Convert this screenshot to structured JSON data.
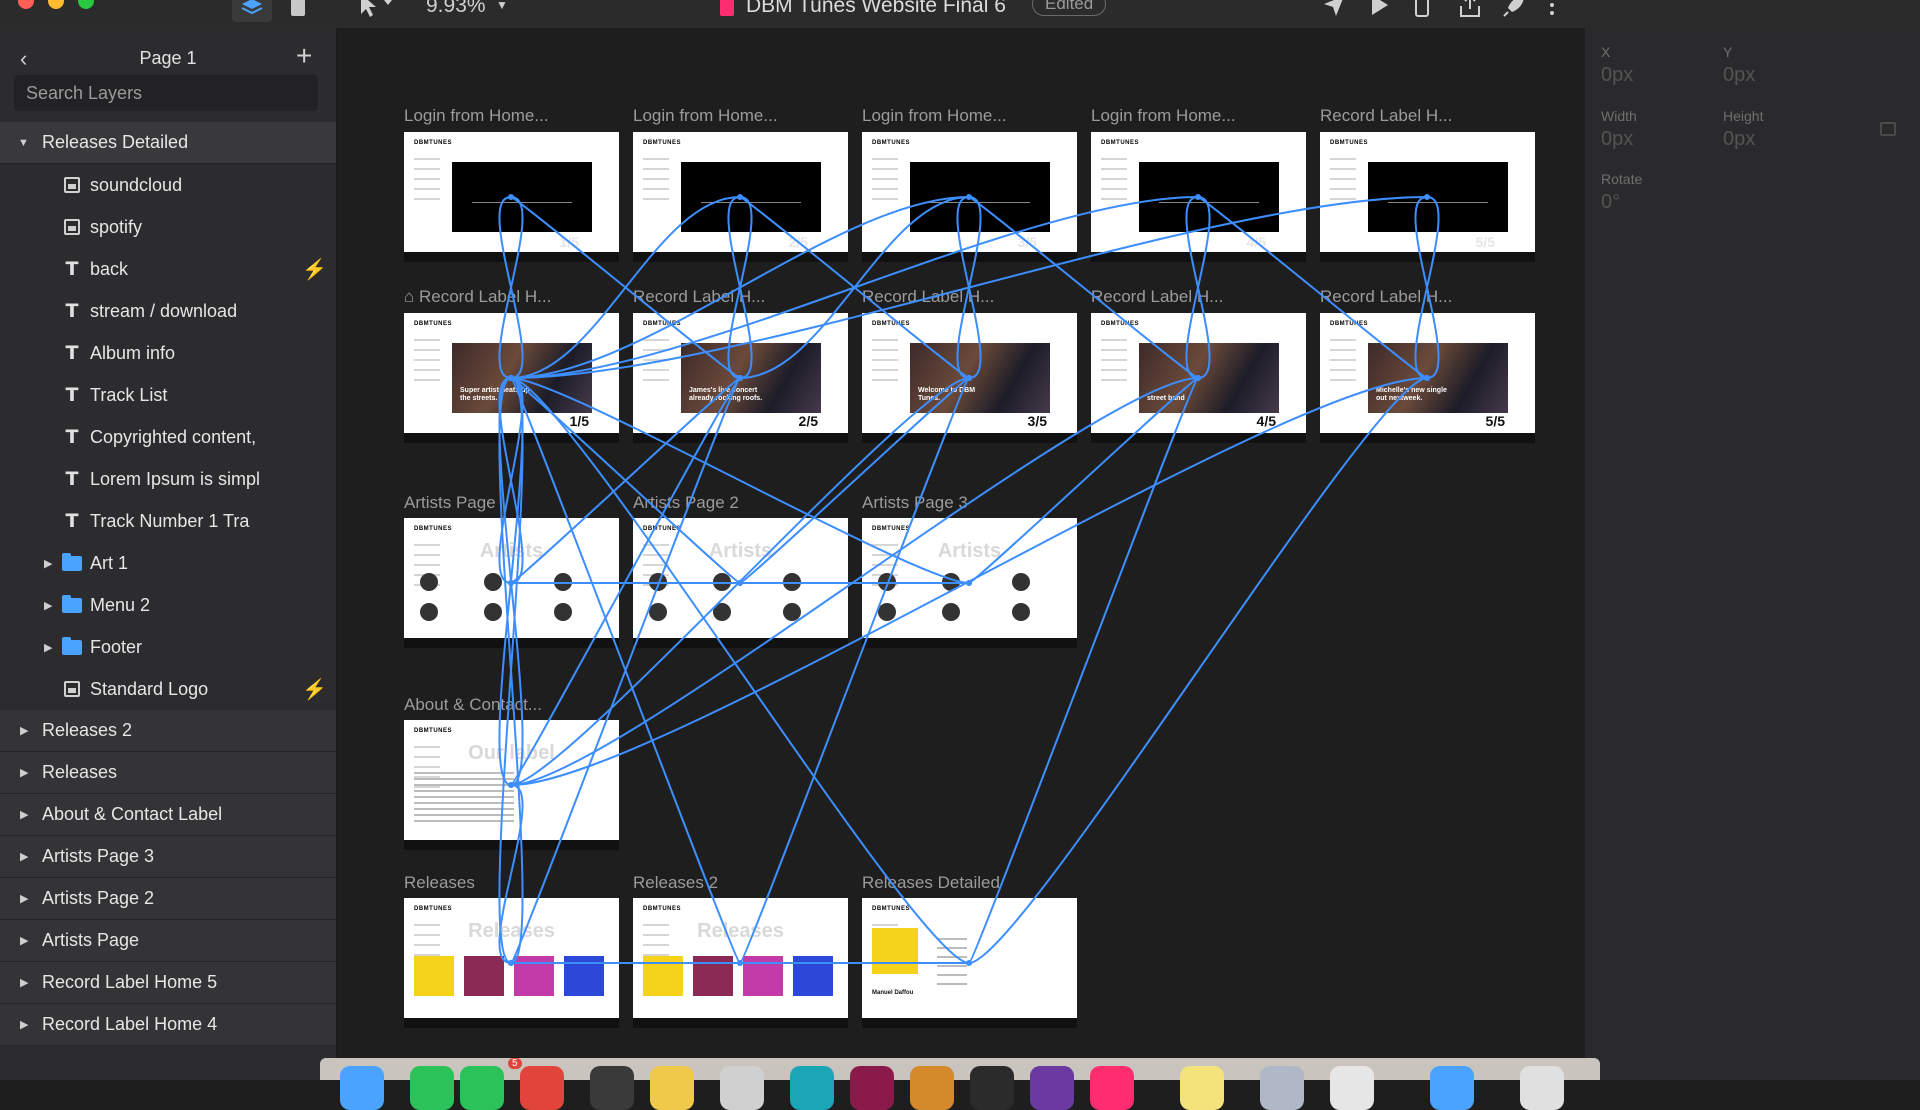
{
  "window": {
    "title": "DBM Tunes Website Final 6",
    "status": "Edited",
    "zoom": "9.93%"
  },
  "left_panel": {
    "page_name": "Page 1",
    "search_placeholder": "Search Layers",
    "layers": [
      {
        "label": "Releases Detailed",
        "kind": "group",
        "expanded": true
      },
      {
        "label": "soundcloud",
        "kind": "image"
      },
      {
        "label": "spotify",
        "kind": "image"
      },
      {
        "label": "back",
        "kind": "text",
        "interaction": true
      },
      {
        "label": "stream / download",
        "kind": "text"
      },
      {
        "label": "Album info",
        "kind": "text"
      },
      {
        "label": "Track List",
        "kind": "text"
      },
      {
        "label": "Copyrighted content,",
        "kind": "text"
      },
      {
        "label": "Lorem Ipsum is simpl",
        "kind": "text"
      },
      {
        "label": "Track Number 1 Tra",
        "kind": "text"
      },
      {
        "label": "Art 1",
        "kind": "folder"
      },
      {
        "label": "Menu 2",
        "kind": "folder"
      },
      {
        "label": "Footer",
        "kind": "folder"
      },
      {
        "label": "Standard Logo",
        "kind": "image",
        "interaction": true
      },
      {
        "label": "Releases 2",
        "kind": "artboard"
      },
      {
        "label": "Releases",
        "kind": "artboard"
      },
      {
        "label": "About & Contact Label",
        "kind": "artboard"
      },
      {
        "label": "Artists Page 3",
        "kind": "artboard"
      },
      {
        "label": "Artists Page 2",
        "kind": "artboard"
      },
      {
        "label": "Artists Page",
        "kind": "artboard"
      },
      {
        "label": "Record Label Home 5",
        "kind": "artboard"
      },
      {
        "label": "Record Label Home 4",
        "kind": "artboard"
      }
    ]
  },
  "canvas": {
    "artboards": [
      {
        "title": "Login from Home...",
        "num": "1/5",
        "kind": "login"
      },
      {
        "title": "Login from Home...",
        "num": "2/5",
        "kind": "login"
      },
      {
        "title": "Login from Home...",
        "num": "3/5",
        "kind": "login"
      },
      {
        "title": "Login from Home...",
        "num": "4/5",
        "kind": "login"
      },
      {
        "title": "Record Label H...",
        "num": "5/5",
        "kind": "login"
      },
      {
        "title": "Record Label H...",
        "num": "1/5",
        "kind": "home",
        "caption": "Super artist heats up the streets.",
        "is_home": true
      },
      {
        "title": "Record Label H...",
        "num": "2/5",
        "kind": "home",
        "caption": "James's live concert already rocking roofs."
      },
      {
        "title": "Record Label H...",
        "num": "3/5",
        "kind": "home",
        "caption": "Welcome to DBM Tunes."
      },
      {
        "title": "Record Label H...",
        "num": "4/5",
        "kind": "home",
        "caption": "street band"
      },
      {
        "title": "Record Label H...",
        "num": "5/5",
        "kind": "home",
        "caption": "Michelle's new single out nextweek."
      },
      {
        "title": "Artists Page",
        "kind": "artists",
        "heading": "Artists"
      },
      {
        "title": "Artists Page 2",
        "kind": "artists",
        "heading": "Artists"
      },
      {
        "title": "Artists Page 3",
        "kind": "artists",
        "heading": "Artists"
      },
      {
        "title": "About & Contact...",
        "kind": "about",
        "heading": "Our label"
      },
      {
        "title": "Releases",
        "kind": "releases",
        "heading": "Releases"
      },
      {
        "title": "Releases 2",
        "kind": "releases",
        "heading": "Releases"
      },
      {
        "title": "Releases Detailed",
        "kind": "detailed",
        "heading": "Manuel Daffou"
      }
    ],
    "logo_text": "DBMTUNES",
    "flow_color": "#3d8eff"
  },
  "inspector": {
    "x_label": "X",
    "x_value": "0px",
    "y_label": "Y",
    "y_value": "0px",
    "width_label": "Width",
    "width_value": "0px",
    "height_label": "Height",
    "height_value": "0px",
    "rotate_label": "Rotate",
    "rotate_value": "0°"
  },
  "icons": {
    "layers_toggle": "layers-icon",
    "pages_toggle": "document-icon",
    "pointer": "pointer-icon",
    "preview": "play-icon",
    "device": "phone-icon",
    "share": "share-icon",
    "publish": "rocket-icon",
    "more": "more-icon"
  },
  "colors": {
    "accent": "#3d8eff",
    "doc_badge": "#ff2d6f",
    "panel": "#2c2c2e",
    "canvas": "#1e1e1e"
  },
  "dock": {
    "badge": "5"
  }
}
